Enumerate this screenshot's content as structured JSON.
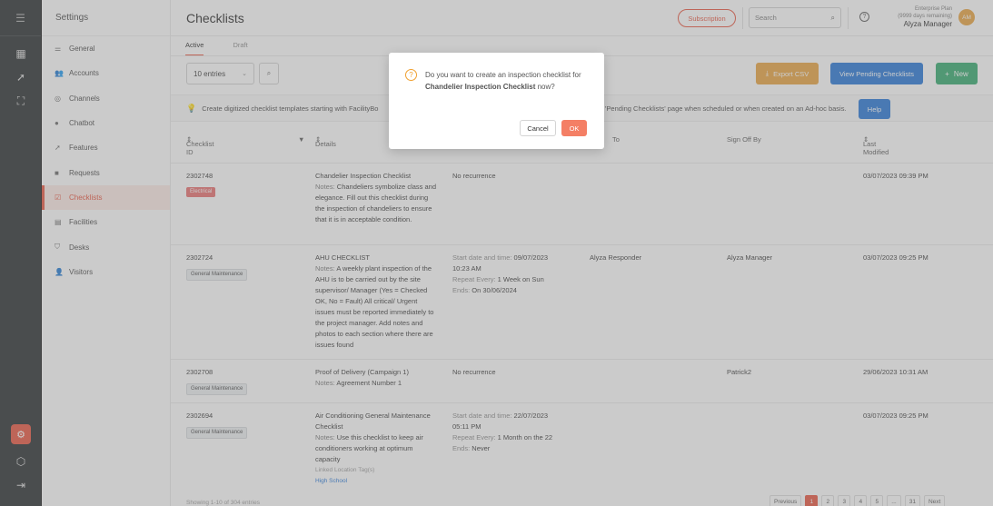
{
  "header": {
    "title": "Checklists",
    "subscription_label": "Subscription",
    "search_placeholder": "Search",
    "plan_line1": "Enterprise Plan",
    "plan_line2": "(9999 days remaining)",
    "user_name": "Alyza Manager",
    "avatar_initials": "AM"
  },
  "sidebar": {
    "title": "Settings",
    "items": [
      {
        "label": "General",
        "icon": "sliders-icon"
      },
      {
        "label": "Accounts",
        "icon": "users-icon"
      },
      {
        "label": "Channels",
        "icon": "globe-icon"
      },
      {
        "label": "Chatbot",
        "icon": "chat-icon"
      },
      {
        "label": "Features",
        "icon": "rocket-icon"
      },
      {
        "label": "Requests",
        "icon": "request-icon"
      },
      {
        "label": "Checklists",
        "icon": "checklist-icon"
      },
      {
        "label": "Facilities",
        "icon": "calendar-icon"
      },
      {
        "label": "Desks",
        "icon": "desk-icon"
      },
      {
        "label": "Visitors",
        "icon": "visitor-icon"
      }
    ]
  },
  "tabs": [
    "Active",
    "Draft"
  ],
  "controls": {
    "entries": "10 entries",
    "export": "Export CSV",
    "pending": "View Pending Checklists",
    "new": "New"
  },
  "banner": {
    "text_left": "Create digitized checklist templates starting with FacilityBo",
    "text_right": "'Pending Checklists' page when scheduled or when created on an Ad-hoc basis.",
    "help": "Help"
  },
  "table": {
    "headers": [
      "Checklist ID",
      "Details",
      "To",
      "Sign Off By",
      "Last Modified"
    ],
    "rows": [
      {
        "id": "2302748",
        "tag": "Electrical",
        "title": "Chandelier Inspection Checklist",
        "notes_label": "Notes:",
        "notes": "Chandeliers symbolize class and elegance. Fill out this checklist during the inspection of chandeliers to ensure that it is in acceptable condition.",
        "recurrence": "No recurrence",
        "assign": "",
        "signoff": "",
        "modified": "03/07/2023 09:39 PM"
      },
      {
        "id": "2302724",
        "tag": "General Maintenance",
        "title": "AHU CHECKLIST",
        "notes_label": "Notes:",
        "notes": "A weekly plant inspection of the AHU is to be carried out by the site supervisor/ Manager (Yes = Checked OK, No = Fault) All critical/ Urgent issues must be reported immediately to the project manager. Add notes and photos to each section where there are issues found",
        "start_label": "Start date and time:",
        "start": "09/07/2023 10:23 AM",
        "repeat_label": "Repeat Every:",
        "repeat": "1 Week on Sun",
        "ends_label": "Ends:",
        "ends": "On 30/06/2024",
        "assign": "Alyza Responder",
        "signoff": "Alyza Manager",
        "modified": "03/07/2023 09:25 PM"
      },
      {
        "id": "2302708",
        "tag": "General Maintenance",
        "title": "Proof of Delivery (Campaign 1)",
        "notes_label": "Notes:",
        "notes": "Agreement Number 1",
        "recurrence": "No recurrence",
        "assign": "",
        "signoff": "Patrick2",
        "modified": "29/06/2023 10:31 AM"
      },
      {
        "id": "2302694",
        "tag": "General Maintenance",
        "title": "Air Conditioning General Maintenance Checklist",
        "notes_label": "Notes:",
        "notes": "Use this checklist to keep air conditioners working at optimum capacity",
        "linked_label": "Linked Location Tag(s)",
        "linked": "High School",
        "start_label": "Start date and time:",
        "start": "22/07/2023 05:11 PM",
        "repeat_label": "Repeat Every:",
        "repeat": "1 Month on the 22",
        "ends_label": "Ends:",
        "ends": "Never",
        "assign": "",
        "signoff": "",
        "modified": "03/07/2023 09:25 PM"
      }
    ]
  },
  "footer": {
    "showing": "Showing 1-10 of 304 entries",
    "pages": [
      "Previous",
      "1",
      "2",
      "3",
      "4",
      "5",
      "...",
      "31",
      "Next"
    ]
  },
  "modal": {
    "message_pre": "Do you want to create an inspection checklist for",
    "message_bold": "Chandelier Inspection Checklist",
    "message_post": "now?",
    "cancel": "Cancel",
    "ok": "OK"
  },
  "colors": {
    "accent": "#e8503a",
    "export": "#e8a13a",
    "pending": "#1f73d6",
    "new": "#2ea86a",
    "ok": "#f47f65"
  }
}
